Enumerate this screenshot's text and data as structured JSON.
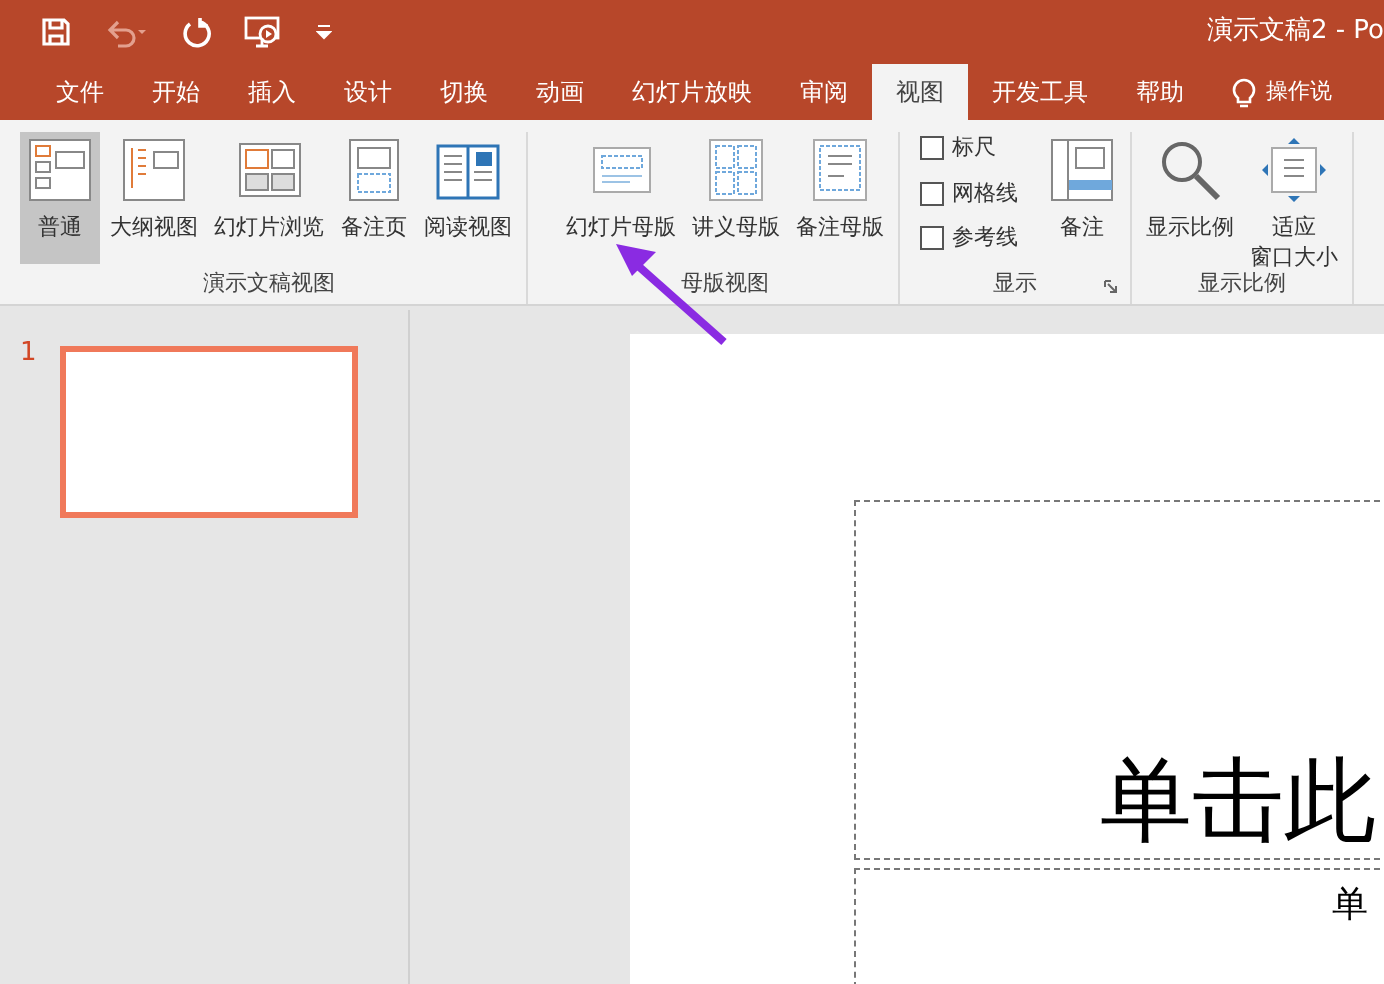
{
  "window": {
    "title": "演示文稿2 - Po"
  },
  "tabs": [
    {
      "label": "文件",
      "selected": false
    },
    {
      "label": "开始",
      "selected": false
    },
    {
      "label": "插入",
      "selected": false
    },
    {
      "label": "设计",
      "selected": false
    },
    {
      "label": "切换",
      "selected": false
    },
    {
      "label": "动画",
      "selected": false
    },
    {
      "label": "幻灯片放映",
      "selected": false
    },
    {
      "label": "审阅",
      "selected": false
    },
    {
      "label": "视图",
      "selected": true
    },
    {
      "label": "开发工具",
      "selected": false
    },
    {
      "label": "帮助",
      "selected": false
    }
  ],
  "tell_me": {
    "label": "操作说"
  },
  "groups": [
    {
      "label": "演示文稿视图",
      "items": [
        {
          "kind": "button",
          "label": "普通",
          "selected": true
        },
        {
          "kind": "button",
          "label": "大纲视图",
          "selected": false
        },
        {
          "kind": "button",
          "label": "幻灯片浏览",
          "selected": false
        },
        {
          "kind": "button",
          "label": "备注页",
          "selected": false
        },
        {
          "kind": "button",
          "label": "阅读视图",
          "selected": false
        }
      ]
    },
    {
      "label": "母版视图",
      "items": [
        {
          "kind": "button",
          "label": "幻灯片母版",
          "selected": false
        },
        {
          "kind": "button",
          "label": "讲义母版",
          "selected": false
        },
        {
          "kind": "button",
          "label": "备注母版",
          "selected": false
        }
      ]
    },
    {
      "label": "显示",
      "launcher": true,
      "items": [
        {
          "kind": "checks",
          "checks": [
            {
              "label": "标尺",
              "checked": false
            },
            {
              "label": "网格线",
              "checked": false
            },
            {
              "label": "参考线",
              "checked": false
            }
          ]
        },
        {
          "kind": "button",
          "label": "备注",
          "selected": false
        }
      ]
    },
    {
      "label": "显示比例",
      "items": [
        {
          "kind": "button",
          "label": "显示比例",
          "selected": false
        },
        {
          "kind": "button",
          "lines": [
            "适应",
            "窗口大小"
          ],
          "selected": false
        }
      ]
    }
  ],
  "slides": [
    {
      "number": "1",
      "selected": true
    }
  ],
  "slide": {
    "title": "单击此",
    "subtitle": "单"
  }
}
